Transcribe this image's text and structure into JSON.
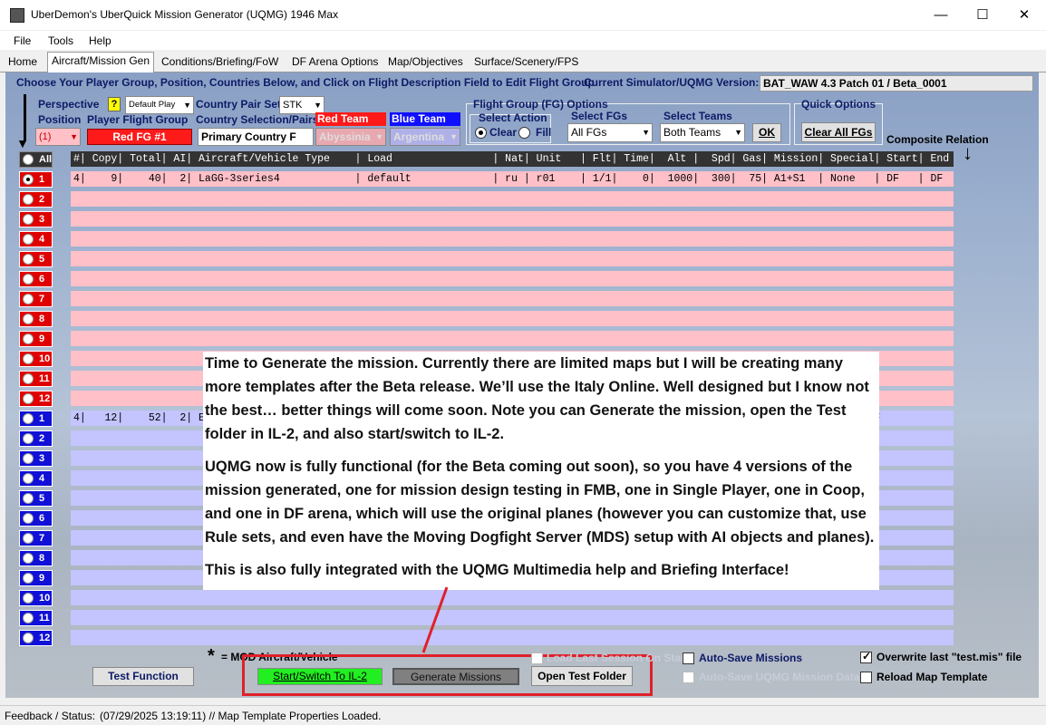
{
  "window": {
    "title": "UberDemon's UberQuick Mission Generator (UQMG) 1946 Max",
    "minimize": "—",
    "maximize": "☐",
    "close": "✕"
  },
  "menu": {
    "file": "File",
    "tools": "Tools",
    "help": "Help"
  },
  "tabs": [
    "Home",
    "Aircraft/Mission Gen",
    "Conditions/Briefing/FoW",
    "DF Arena Options",
    "Map/Objectives",
    "Surface/Scenery/FPS"
  ],
  "header": {
    "instruction": "Choose Your Player Group, Position, Countries Below, and Click on Flight Description Field to Edit Flight Group",
    "version_label": "Current Simulator/UQMG Version:",
    "version_value": "BAT_WAW 4.3 Patch 01 / Beta_0001"
  },
  "controls": {
    "perspective_label": "Perspective",
    "help_badge": "?",
    "perspective_value": "Default Play",
    "position_label": "Position",
    "position_value": "(1)",
    "player_fg_label": "Player Flight Group",
    "player_fg_value": "Red FG #1",
    "country_pair_label": "Country Pair Set",
    "country_pair_value": "STK",
    "country_selection_label": "Country Selection/Pairs",
    "country_selection_value": "Primary Country F",
    "red_team_label": "Red Team",
    "red_team_value": "Abyssinia",
    "blue_team_label": "Blue Team",
    "blue_team_value": "Argentina",
    "fg_options_label": "Flight Group (FG) Options",
    "select_action_label": "Select Action",
    "clear_label": "Clear",
    "fill_label": "Fill",
    "select_fgs_label": "Select FGs",
    "select_fgs_value": "All FGs",
    "select_teams_label": "Select Teams",
    "select_teams_value": "Both Teams",
    "ok_label": "OK",
    "quick_options_label": "Quick Options",
    "clear_all_label": "Clear All FGs",
    "composite_label": "Composite Relation"
  },
  "table": {
    "all_label": "All",
    "header": "#| Copy| Total| AI| Aircraft/Vehicle Type    | Load                | Nat| Unit   | Flt| Time|  Alt |  Spd| Gas| Mission| Special| Start| End",
    "red_rows": [
      {
        "num": "1",
        "text": "4|    9|    40|  2| LaGG-3series4            | default             | ru | r01    | 1/1|    0|  1000|  300|  75| A1+S1  | None   | DF   | DF"
      },
      {
        "num": "2",
        "text": ""
      },
      {
        "num": "3",
        "text": ""
      },
      {
        "num": "4",
        "text": ""
      },
      {
        "num": "5",
        "text": ""
      },
      {
        "num": "6",
        "text": ""
      },
      {
        "num": "7",
        "text": ""
      },
      {
        "num": "8",
        "text": ""
      },
      {
        "num": "9",
        "text": ""
      },
      {
        "num": "10",
        "text": ""
      },
      {
        "num": "11",
        "text": ""
      },
      {
        "num": "12",
        "text": ""
      }
    ],
    "blue_rows": [
      {
        "num": "1",
        "text": "4|   12|    52|  2| E                                                                                                        | DF"
      },
      {
        "num": "2",
        "text": ""
      },
      {
        "num": "3",
        "text": ""
      },
      {
        "num": "4",
        "text": ""
      },
      {
        "num": "5",
        "text": ""
      },
      {
        "num": "6",
        "text": ""
      },
      {
        "num": "7",
        "text": ""
      },
      {
        "num": "8",
        "text": ""
      },
      {
        "num": "9",
        "text": ""
      },
      {
        "num": "10",
        "text": ""
      },
      {
        "num": "11",
        "text": ""
      },
      {
        "num": "12",
        "text": ""
      }
    ]
  },
  "overlay": {
    "p1": "Time to Generate the mission.  Currently there are limited maps but I will be creating many more templates after the Beta release.  We’ll use the Italy Online.  Well designed but I know not the best… better things will come soon.  Note you can Generate the mission, open the Test folder in IL-2, and also start/switch to IL-2.",
    "p2": "UQMG now is fully functional (for the Beta coming out soon), so you have 4 versions of the mission generated, one for mission design testing in FMB, one in Single Player, one in Coop, and one in DF arena, which will use the original planes (however you can customize that, use Rule sets, and even have the Moving Dogfight Server (MDS) setup with AI objects and planes).",
    "p3": "This is also fully integrated with the UQMG Multimedia help and Briefing Interface!"
  },
  "bottom": {
    "mod_star": "*",
    "mod_label": "= MOD Aircraft/Vehicle",
    "test_function": "Test Function",
    "start_switch": "Start/Switch To IL-2",
    "generate": "Generate Missions",
    "open_test": "Open Test Folder",
    "load_last": "Load Last Session On Start",
    "auto_save_missions": "Auto-Save Missions",
    "auto_save_uqmg": "Auto-Save UQMG Mission Data",
    "overwrite": "Overwrite last \"test.mis\" file",
    "reload_map": "Reload Map Template"
  },
  "status": {
    "label": "Feedback / Status:",
    "message": "(07/29/2025 13:19:11) // Map Template Properties Loaded."
  },
  "colors": {
    "red_team": "#e00000",
    "blue_team": "#1010d8",
    "accent_green": "#22ee22",
    "annotation": "#e0202a"
  }
}
